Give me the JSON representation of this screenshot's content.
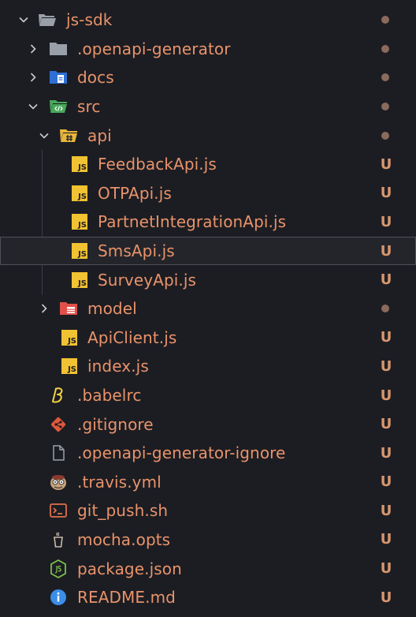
{
  "tree": {
    "root": {
      "label": "js-sdk",
      "status": "dot"
    },
    "items": [
      {
        "label": ".openapi-generator",
        "status": "dot",
        "icon": "gray-folder-icon"
      },
      {
        "label": "docs",
        "status": "dot",
        "icon": "docs-folder-icon"
      },
      {
        "label": "src",
        "status": "dot",
        "icon": "src-folder-icon"
      },
      {
        "label": "api",
        "status": "dot",
        "icon": "api-folder-icon"
      },
      {
        "label": "FeedbackApi.js",
        "status": "U",
        "icon": "js-icon"
      },
      {
        "label": "OTPApi.js",
        "status": "U",
        "icon": "js-icon"
      },
      {
        "label": "PartnetIntegrationApi.js",
        "status": "U",
        "icon": "js-icon"
      },
      {
        "label": "SmsApi.js",
        "status": "U",
        "icon": "js-icon"
      },
      {
        "label": "SurveyApi.js",
        "status": "U",
        "icon": "js-icon"
      },
      {
        "label": "model",
        "status": "dot",
        "icon": "model-folder-icon"
      },
      {
        "label": "ApiClient.js",
        "status": "U",
        "icon": "js-icon"
      },
      {
        "label": "index.js",
        "status": "U",
        "icon": "js-icon"
      },
      {
        "label": ".babelrc",
        "status": "U",
        "icon": "babel-icon"
      },
      {
        "label": ".gitignore",
        "status": "U",
        "icon": "git-icon"
      },
      {
        "label": ".openapi-generator-ignore",
        "status": "U",
        "icon": "file-icon"
      },
      {
        "label": ".travis.yml",
        "status": "U",
        "icon": "travis-icon"
      },
      {
        "label": "git_push.sh",
        "status": "U",
        "icon": "shell-icon"
      },
      {
        "label": "mocha.opts",
        "status": "U",
        "icon": "mocha-icon"
      },
      {
        "label": "package.json",
        "status": "U",
        "icon": "nodejs-icon"
      },
      {
        "label": "README.md",
        "status": "U",
        "icon": "info-icon"
      }
    ],
    "js_icon_text": "JS",
    "colors": {
      "background": "#1c1d23",
      "label": "#e9936a",
      "badge": "#d8976e",
      "dot": "#8a6a5c",
      "selected_border": "#4d5057"
    }
  }
}
